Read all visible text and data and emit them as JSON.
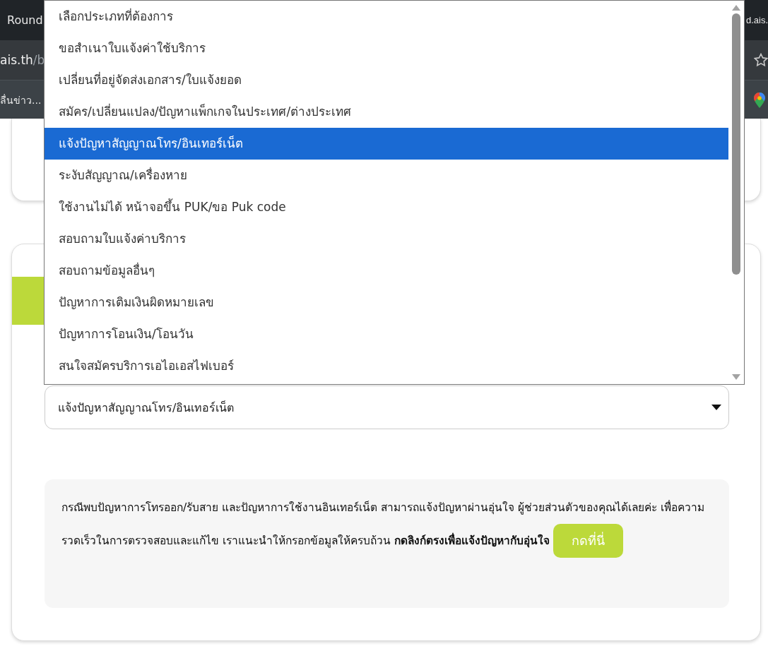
{
  "browser": {
    "tab_title": "Round",
    "address_host": "ais.th",
    "address_path": "/b",
    "bookmark": "ลื่นข่าว...",
    "right_address": "d.ais."
  },
  "dropdown": {
    "options": [
      {
        "label": "เลือกประเภทที่ต้องการ",
        "selected": false
      },
      {
        "label": "ขอสำเนาใบแจ้งค่าใช้บริการ",
        "selected": false
      },
      {
        "label": "เปลี่ยนที่อยู่จัดส่งเอกสาร/ใบแจ้งยอด",
        "selected": false
      },
      {
        "label": "สมัคร/เปลี่ยนแปลง/ปัญหาแพ็กเกจในประเทศ/ต่างประเทศ",
        "selected": false
      },
      {
        "label": "แจ้งปัญหาสัญญาณโทร/อินเทอร์เน็ต",
        "selected": true
      },
      {
        "label": "ระงับสัญญาณ/เครื่องหาย",
        "selected": false
      },
      {
        "label": "ใช้งานไม่ได้ หน้าจอขึ้น PUK/ขอ Puk code",
        "selected": false
      },
      {
        "label": "สอบถามใบแจ้งค่าบริการ",
        "selected": false
      },
      {
        "label": "สอบถามข้อมูลอื่นๆ",
        "selected": false
      },
      {
        "label": "ปัญหาการเติมเงินผิดหมายเลข",
        "selected": false
      },
      {
        "label": "ปัญหาการโอนเงิน/โอนวัน",
        "selected": false
      },
      {
        "label": "สนใจสมัครบริการเอไอเอสไฟเบอร์",
        "selected": false
      }
    ]
  },
  "select": {
    "value": "แจ้งปัญหาสัญญาณโทร/อินเทอร์เน็ต"
  },
  "info": {
    "text": "กรณีพบปัญหาการโทรออก/รับสาย และปัญหาการใช้งานอินเทอร์เน็ต สามารถแจ้งปัญหาผ่านอุ่นใจ ผู้ช่วยส่วนตัวของคุณได้เลยค่ะ เพื่อความรวดเร็วในการตรวจสอบและแก้ไข เราแนะนำให้กรอกข้อมูลให้ครบถ้วน **กดลิงก์ตรงเพื่อแจ้งปัญหากับอุ่นใจ**",
    "button": "กดที่นี่"
  }
}
